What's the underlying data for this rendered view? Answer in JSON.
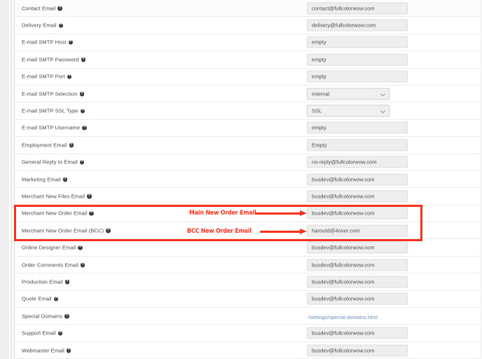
{
  "help_icon": "help-circle-icon",
  "colors": {
    "annotation": "#f8301c",
    "link": "#6a8fbf",
    "field_bg": "#eeeeee",
    "row_border": "#ececec"
  },
  "rows": [
    {
      "label": "Contact Email",
      "type": "text",
      "value": "contact@fullcolorwow.com"
    },
    {
      "label": "Delivery Email",
      "type": "text",
      "value": "delivery@fullcolorwow.com"
    },
    {
      "label": "E-mail SMTP Host",
      "type": "text",
      "value": "empty"
    },
    {
      "label": "E-mail SMTP Password",
      "type": "text",
      "value": "empty"
    },
    {
      "label": "E-mail SMTP Port",
      "type": "text",
      "value": "empty"
    },
    {
      "label": "E-mail SMTP Selection",
      "type": "select",
      "value": "Internal"
    },
    {
      "label": "E-mail SMTP SSL Type",
      "type": "select",
      "value": "SSL"
    },
    {
      "label": "E-mail SMTP Username",
      "type": "text",
      "value": "empty"
    },
    {
      "label": "Employment Email",
      "type": "text",
      "value": "Empty"
    },
    {
      "label": "General Reply to Email",
      "type": "text",
      "value": "no-reply@fullcolorwow.com"
    },
    {
      "label": "Marketing Email",
      "type": "text",
      "value": "busdev@fullcolorwow.com"
    },
    {
      "label": "Merchant New Files Email",
      "type": "text",
      "value": "busdev@fullcolorwow.com"
    },
    {
      "label": "Merchant New Order Email",
      "type": "text",
      "value": "busdev@fullcolorwow.com"
    },
    {
      "label": "Merchant New Order Email (BCC)",
      "type": "text",
      "value": "haroutd@4over.com"
    },
    {
      "label": "Online Designer Email",
      "type": "text",
      "value": "busdev@fullcolorwow.com"
    },
    {
      "label": "Order Comments Email",
      "type": "text",
      "value": "busdev@fullcolorwow.com"
    },
    {
      "label": "Production Email",
      "type": "text",
      "value": "busdev@fullcolorwow.com"
    },
    {
      "label": "Quote Email",
      "type": "text",
      "value": "busdev@fullcolorwow.com"
    },
    {
      "label": "Special Domains",
      "type": "link",
      "value": "/settings/special-domains.html"
    },
    {
      "label": "Support Email",
      "type": "text",
      "value": "busdev@fullcolorwow.com"
    },
    {
      "label": "Webmaster Email",
      "type": "text",
      "value": "busdev@fullcolorwow.com"
    }
  ],
  "annotations": {
    "main_note": "Main New Order Email",
    "bcc_note": "BCC New Order Email"
  }
}
